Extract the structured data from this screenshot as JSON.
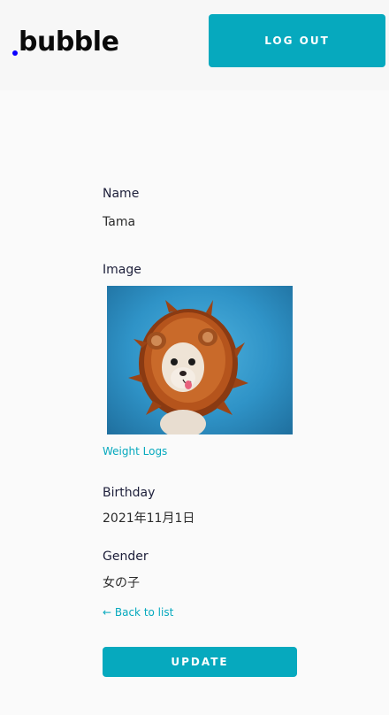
{
  "header": {
    "logo_text": "bubble",
    "logout_label": "LOG OUT"
  },
  "fields": {
    "name_label": "Name",
    "name_value": "Tama",
    "image_label": "Image",
    "birthday_label": "Birthday",
    "birthday_value": "2021年11月1日",
    "gender_label": "Gender",
    "gender_value": "女の子"
  },
  "links": {
    "weight_logs": "Weight Logs",
    "back_to_list": "← Back to list"
  },
  "actions": {
    "update_label": "UPDATE"
  },
  "colors": {
    "accent": "#06a9be",
    "logo_dot": "#0b00ff"
  }
}
